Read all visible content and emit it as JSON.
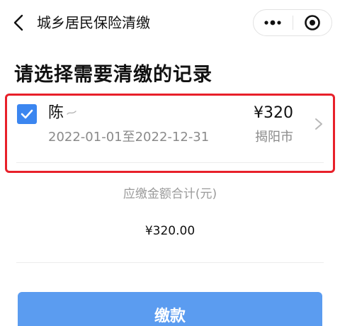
{
  "header": {
    "title": "城乡居民保险清缴",
    "back_icon": "chevron-left-icon",
    "more_icon": "more-dots-icon",
    "close_icon": "target-close-icon"
  },
  "page_heading": "请选择需要清缴的记录",
  "record": {
    "checked": true,
    "name": "陈",
    "period": "2022-01-01至2022-12-31",
    "amount": "¥320",
    "city": "揭阳市",
    "highlight_color": "#e8202a"
  },
  "summary": {
    "label": "应缴金额合计(元)",
    "amount": "¥320.00"
  },
  "pay_button": {
    "label": "缴款",
    "color": "#5b9cf0"
  },
  "colors": {
    "checkbox": "#3b86f0",
    "secondary_text": "#8a8a8a"
  }
}
